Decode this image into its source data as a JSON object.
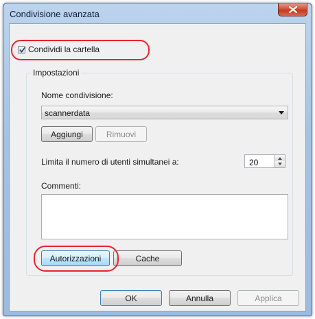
{
  "window": {
    "title": "Condivisione avanzata"
  },
  "share_checkbox": {
    "label": "Condividi la cartella",
    "checked": true
  },
  "settings": {
    "group_label": "Impostazioni",
    "share_name_label": "Nome condivisione:",
    "share_name_value": "scannerdata",
    "add_label": "Aggiungi",
    "remove_label": "Rimuovi",
    "user_limit_label": "Limita il numero di utenti simultanei a:",
    "user_limit_value": "20",
    "comments_label": "Commenti:",
    "comments_value": "",
    "permissions_label": "Autorizzazioni",
    "cache_label": "Cache"
  },
  "footer": {
    "ok_label": "OK",
    "cancel_label": "Annulla",
    "apply_label": "Applica"
  },
  "colors": {
    "highlight": "#e8242e",
    "title_bar": "#a6c3e3",
    "dialog_bg": "#f0f0f0"
  }
}
